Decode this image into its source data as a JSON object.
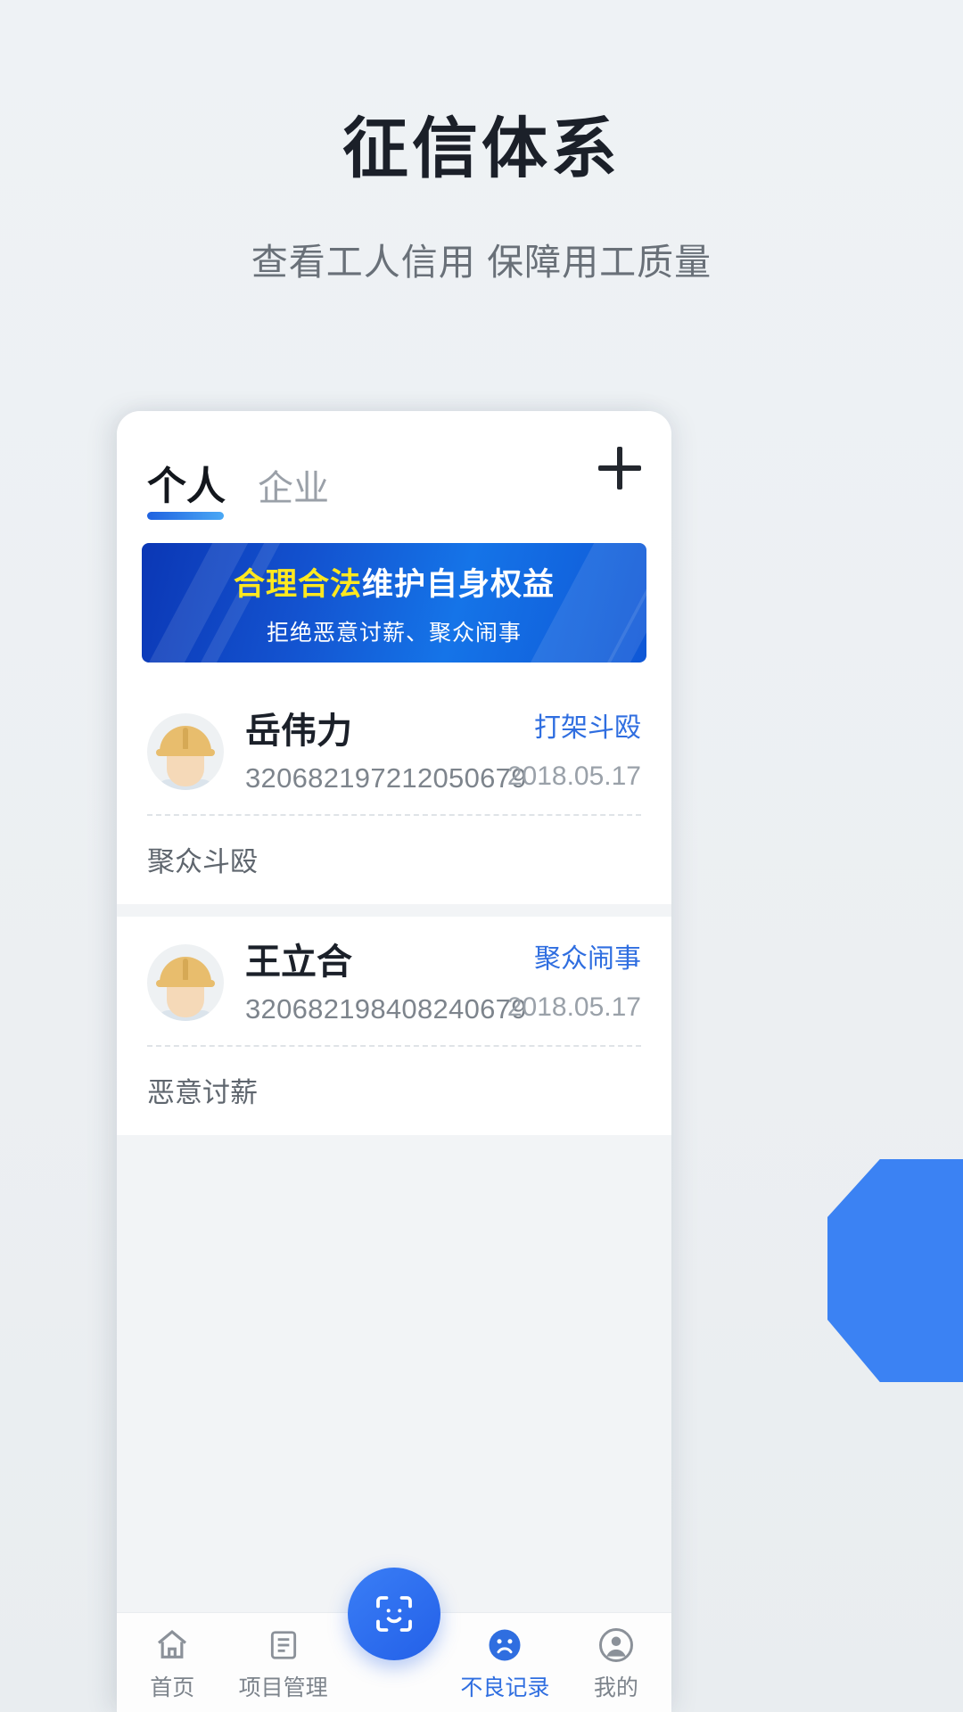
{
  "hero": {
    "title": "征信体系",
    "subtitle": "查看工人信用 保障用工质量"
  },
  "colors": {
    "page_bg": "#edf1f4",
    "accent_blue": "#2f6ee0",
    "banner_highlight": "#ffe81f",
    "hex_decor": "#3b82f3"
  },
  "app": {
    "tabs": [
      {
        "label": "个人",
        "active": true
      },
      {
        "label": "企业",
        "active": false
      }
    ],
    "add_button": {
      "icon": "plus-icon"
    },
    "banner": {
      "line1_highlight": "合理合法",
      "line1_rest": "维护自身权益",
      "line2": "拒绝恶意讨薪、聚众闹事"
    },
    "records": [
      {
        "name": "岳伟力",
        "id_number": "320682197212050679",
        "tag": "打架斗殴",
        "date": "2018.05.17",
        "note": "聚众斗殴"
      },
      {
        "name": "王立合",
        "id_number": "320682198408240679",
        "tag": "聚众闹事",
        "date": "2018.05.17",
        "note": "恶意讨薪"
      }
    ],
    "nav": [
      {
        "label": "首页",
        "icon": "home-icon",
        "active": false
      },
      {
        "label": "项目管理",
        "icon": "list-icon",
        "active": false
      },
      {
        "label": "不良记录",
        "icon": "sad-face-icon",
        "active": true
      },
      {
        "label": "我的",
        "icon": "person-icon",
        "active": false
      }
    ],
    "fab": {
      "icon": "face-scan-icon"
    }
  }
}
